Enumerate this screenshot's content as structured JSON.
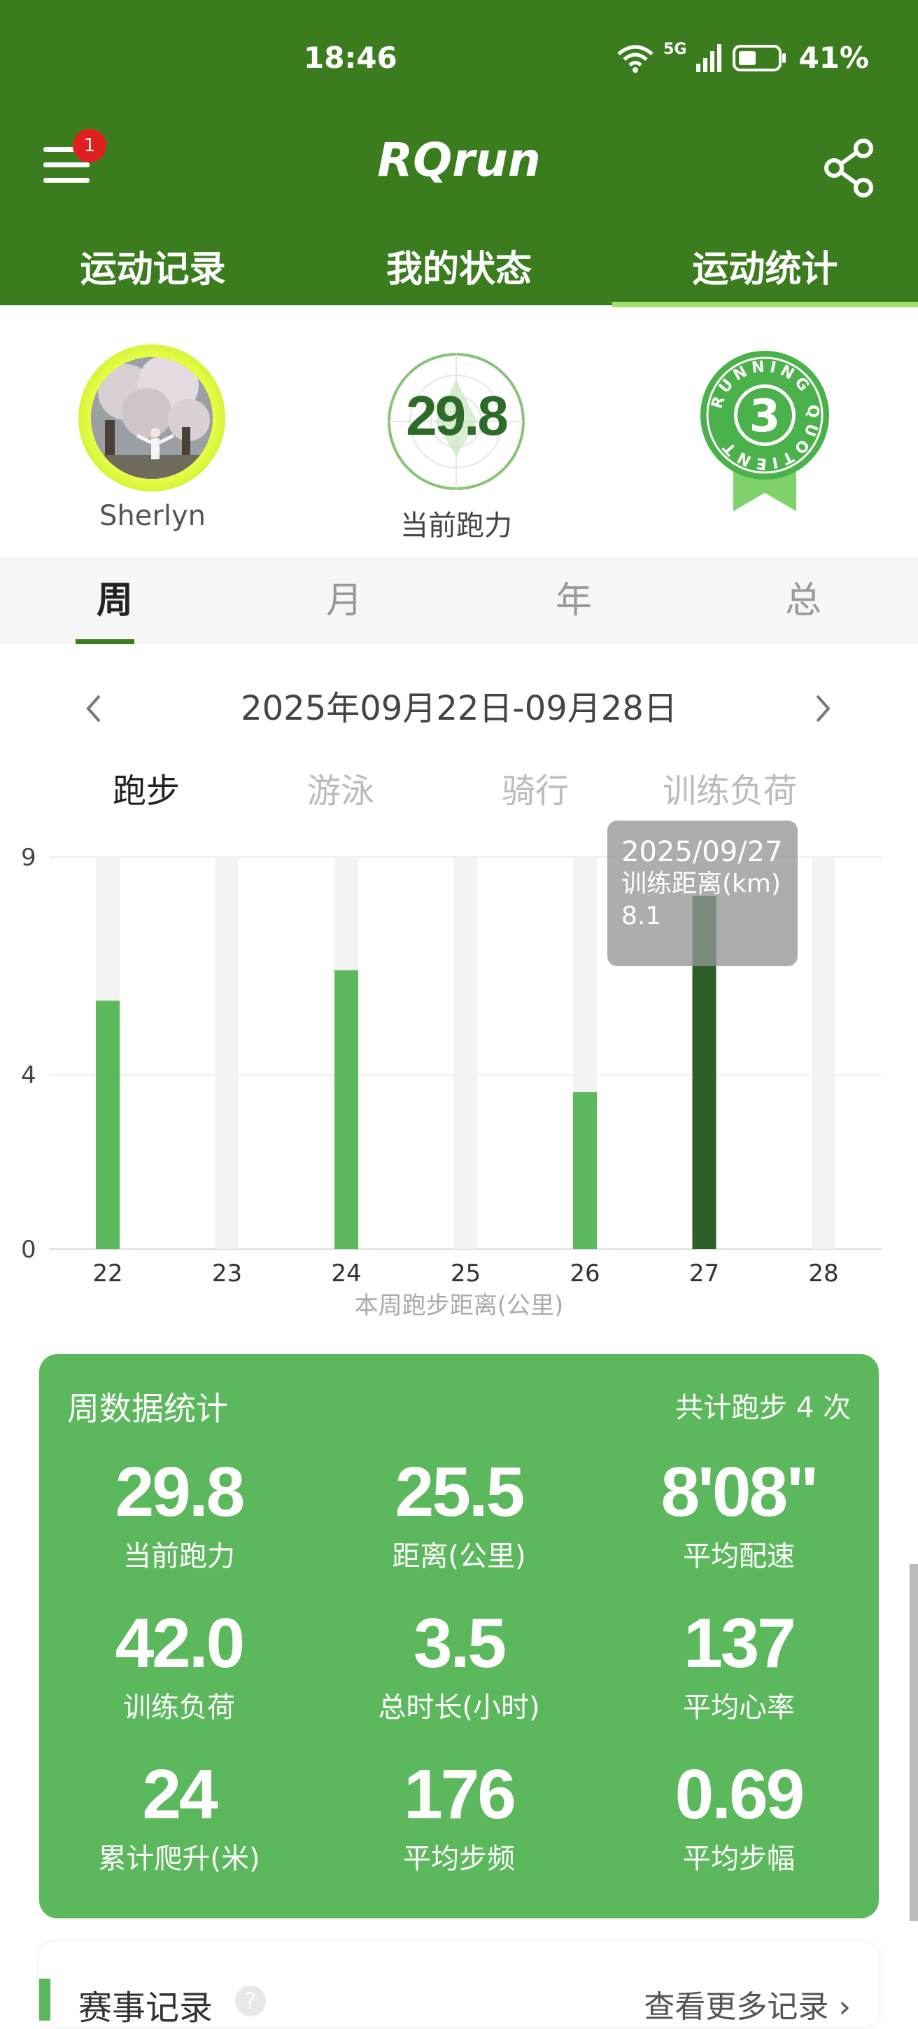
{
  "status": {
    "time": "18:46",
    "battery": "41%",
    "network": "5G"
  },
  "header": {
    "title": "RQrun",
    "badge_count": "1"
  },
  "tabs": [
    {
      "label": "运动记录"
    },
    {
      "label": "我的状态"
    },
    {
      "label": "运动统计",
      "active": true
    }
  ],
  "profile": {
    "username": "Sherlyn",
    "running_power": "29.8",
    "running_power_label": "当前跑力",
    "rq_badge_text": "RUNNING QUOTIENT",
    "rq_level": "3"
  },
  "periods": [
    {
      "label": "周",
      "active": true
    },
    {
      "label": "月"
    },
    {
      "label": "年"
    },
    {
      "label": "总"
    }
  ],
  "week": {
    "prev_icon": "chevron-left-icon",
    "label": "2025年09月22日-09月28日",
    "next_icon": "chevron-right-icon"
  },
  "sports": [
    {
      "label": "跑步",
      "active": true
    },
    {
      "label": "游泳"
    },
    {
      "label": "骑行"
    },
    {
      "label": "训练负荷"
    }
  ],
  "chart_data": {
    "type": "bar",
    "categories": [
      "22",
      "23",
      "24",
      "25",
      "26",
      "27",
      "28"
    ],
    "values": [
      5.7,
      0,
      6.4,
      0,
      3.6,
      8.1,
      0
    ],
    "xlabel": "本周跑步距离(公里)",
    "ylabel": "",
    "ylim": [
      0,
      9
    ],
    "yticks": [
      "0",
      "4",
      "9"
    ],
    "highlight_index": 5,
    "bar_color": "#5cb85c",
    "highlight_color": "#2d5f2a",
    "track_color": "#f3f3f3",
    "tooltip": {
      "date": "2025/09/27",
      "label": "训练距离(km)",
      "value": "8.1"
    }
  },
  "stats": {
    "title": "周数据统计",
    "count": "共计跑步 4 次",
    "items": [
      {
        "value": "29.8",
        "label": "当前跑力"
      },
      {
        "value": "25.5",
        "label": "距离(公里)"
      },
      {
        "value": "8'08\"",
        "label": "平均配速"
      },
      {
        "value": "42.0",
        "label": "训练负荷"
      },
      {
        "value": "3.5",
        "label": "总时长(小时)"
      },
      {
        "value": "137",
        "label": "平均心率"
      },
      {
        "value": "24",
        "label": "累计爬升(米)"
      },
      {
        "value": "176",
        "label": "平均步频"
      },
      {
        "value": "0.69",
        "label": "平均步幅"
      }
    ]
  },
  "records": {
    "title": "赛事记录",
    "help_icon": "?",
    "more_label": "查看更多记录 ›"
  }
}
